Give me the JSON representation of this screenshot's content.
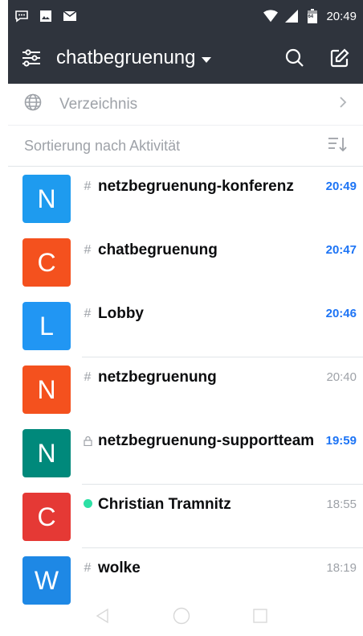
{
  "status_bar": {
    "time": "20:49",
    "battery": "64",
    "icons": [
      "chat-bubble-icon",
      "image-icon",
      "mail-icon",
      "wifi-icon",
      "signal-icon",
      "battery-icon"
    ]
  },
  "header": {
    "title": "chatbegruenung",
    "bg_color": "#2f343d",
    "icons": [
      "sliders-icon",
      "caret-down-icon",
      "search-icon",
      "edit-icon"
    ]
  },
  "directory": {
    "label": "Verzeichnis"
  },
  "sort": {
    "label": "Sortierung nach Aktivität"
  },
  "rooms": [
    {
      "initial": "N",
      "name": "netzbegruenung-konferenz",
      "time": "20:49",
      "type": "channel",
      "type_icon": "#",
      "unread": true,
      "avatar_color": "#1e9bef"
    },
    {
      "initial": "C",
      "name": "chatbegruenung",
      "time": "20:47",
      "type": "channel",
      "type_icon": "#",
      "unread": true,
      "avatar_color": "#f4511e"
    },
    {
      "initial": "L",
      "name": "Lobby",
      "time": "20:46",
      "type": "channel",
      "type_icon": "#",
      "unread": true,
      "avatar_color": "#2196f3"
    },
    {
      "initial": "N",
      "name": "netzbegruenung",
      "time": "20:40",
      "type": "channel",
      "type_icon": "#",
      "unread": false,
      "avatar_color": "#f4511e"
    },
    {
      "initial": "N",
      "name": "netzbegruenung-supportteam",
      "time": "19:59",
      "type": "private",
      "type_icon": "lock",
      "unread": true,
      "avatar_color": "#00897b"
    },
    {
      "initial": "C",
      "name": "Christian Tramnitz",
      "time": "18:55",
      "type": "direct",
      "type_icon": "online",
      "unread": false,
      "avatar_color": "#e53935"
    },
    {
      "initial": "W",
      "name": "wolke",
      "time": "18:19",
      "type": "channel",
      "type_icon": "#",
      "unread": false,
      "avatar_color": "#1e88e5"
    }
  ],
  "colors": {
    "accent": "#1d74f5",
    "online": "#2de0a5",
    "muted": "#9ea2a8"
  }
}
